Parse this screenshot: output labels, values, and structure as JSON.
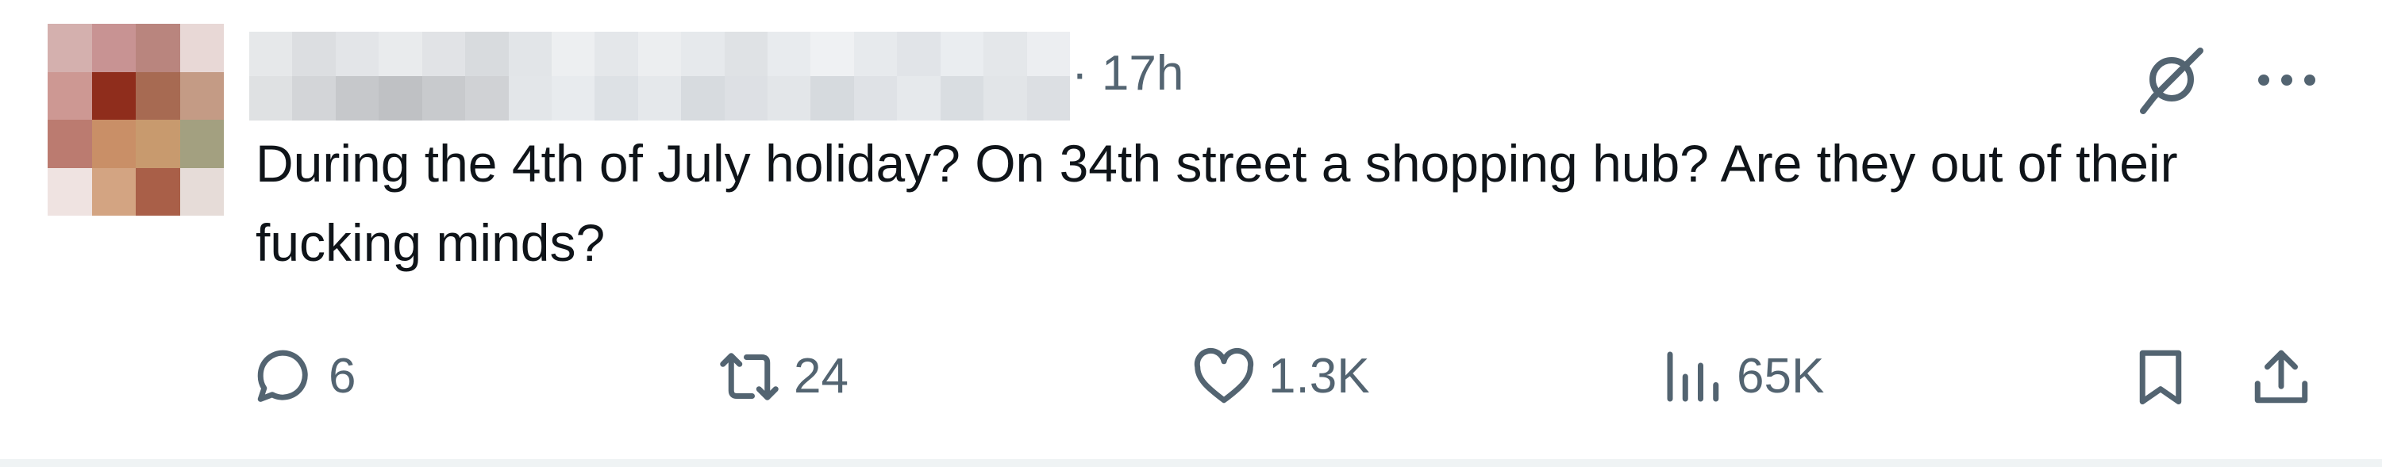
{
  "post": {
    "timestamp": "· 17h",
    "text": "During the 4th of July holiday? On 34th street a shopping hub? Are they out of their fucking minds?",
    "actions": {
      "replies": "6",
      "reposts": "24",
      "likes": "1.3K",
      "views": "65K"
    },
    "icons": {
      "grok": "grok-icon",
      "more": "more-icon",
      "reply": "reply-icon",
      "repost": "repost-icon",
      "like": "heart-icon",
      "views": "views-icon",
      "bookmark": "bookmark-icon",
      "share": "share-icon"
    },
    "colors": {
      "text": "#0f1419",
      "secondary": "#536471",
      "divider": "#eff3f4"
    }
  }
}
